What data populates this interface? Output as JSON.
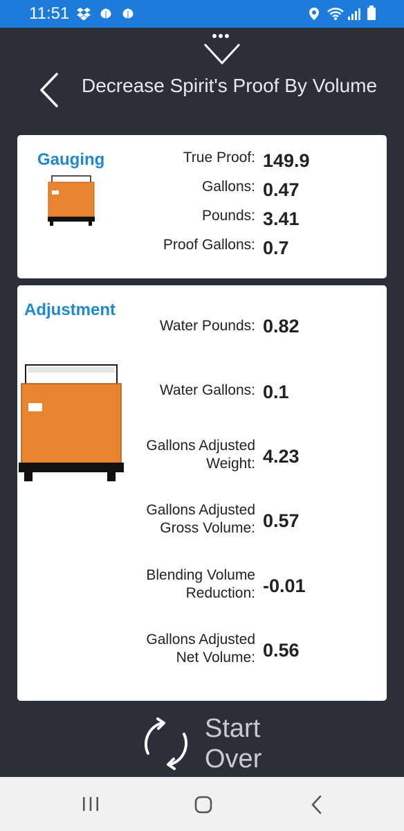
{
  "status_bar": {
    "time": "11:51"
  },
  "header": {
    "title": "Decrease Spirit's Proof By Volume"
  },
  "gauging": {
    "title": "Gauging",
    "rows": [
      {
        "label": "True Proof:",
        "value": "149.9"
      },
      {
        "label": "Gallons:",
        "value": "0.47"
      },
      {
        "label": "Pounds:",
        "value": "3.41"
      },
      {
        "label": "Proof Gallons:",
        "value": "0.7"
      }
    ]
  },
  "adjustment": {
    "title": "Adjustment",
    "rows": [
      {
        "label_line1": "Water Pounds:",
        "label_line2": "",
        "value": "0.82"
      },
      {
        "label_line1": "Water Gallons:",
        "label_line2": "",
        "value": "0.1"
      },
      {
        "label_line1": "Gallons Adjusted",
        "label_line2": "Weight:",
        "value": "4.23"
      },
      {
        "label_line1": "Gallons Adjusted",
        "label_line2": "Gross Volume:",
        "value": "0.57"
      },
      {
        "label_line1": "Blending Volume",
        "label_line2": "Reduction:",
        "value": "-0.01"
      },
      {
        "label_line1": "Gallons Adjusted",
        "label_line2": "Net Volume:",
        "value": "0.56"
      }
    ]
  },
  "footer": {
    "start_over_line1": "Start",
    "start_over_line2": "Over"
  },
  "colors": {
    "status_bar": "#1e7bd9",
    "background": "#2b2f38",
    "accent_title": "#2189c7",
    "tank_orange": "#e8832e"
  },
  "icons": [
    "dropbox-icon",
    "leaf-icon",
    "location-icon",
    "wifi-icon",
    "signal-icon",
    "battery-icon",
    "more-dots-icon",
    "chevron-down-icon",
    "back-arrow-icon",
    "tank-icon",
    "refresh-icon",
    "recent-apps-icon",
    "home-icon",
    "nav-back-icon"
  ]
}
